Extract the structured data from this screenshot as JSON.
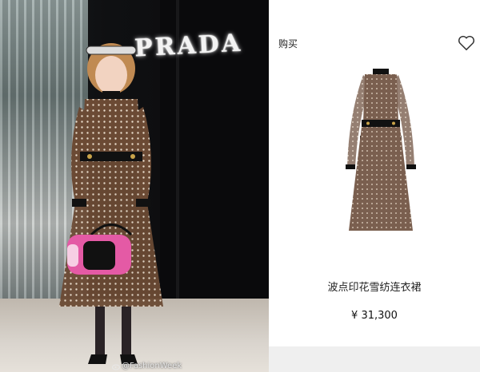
{
  "photo": {
    "brand_sign": "PRADA",
    "watermark": "@FashionWeek"
  },
  "product": {
    "buy_label": "购买",
    "name": "波点印花雪纺连衣裙",
    "price": "¥ 31,300"
  },
  "colors": {
    "dress": "#6b4a34",
    "accent_black": "#111111",
    "gold": "#c9a44a"
  }
}
